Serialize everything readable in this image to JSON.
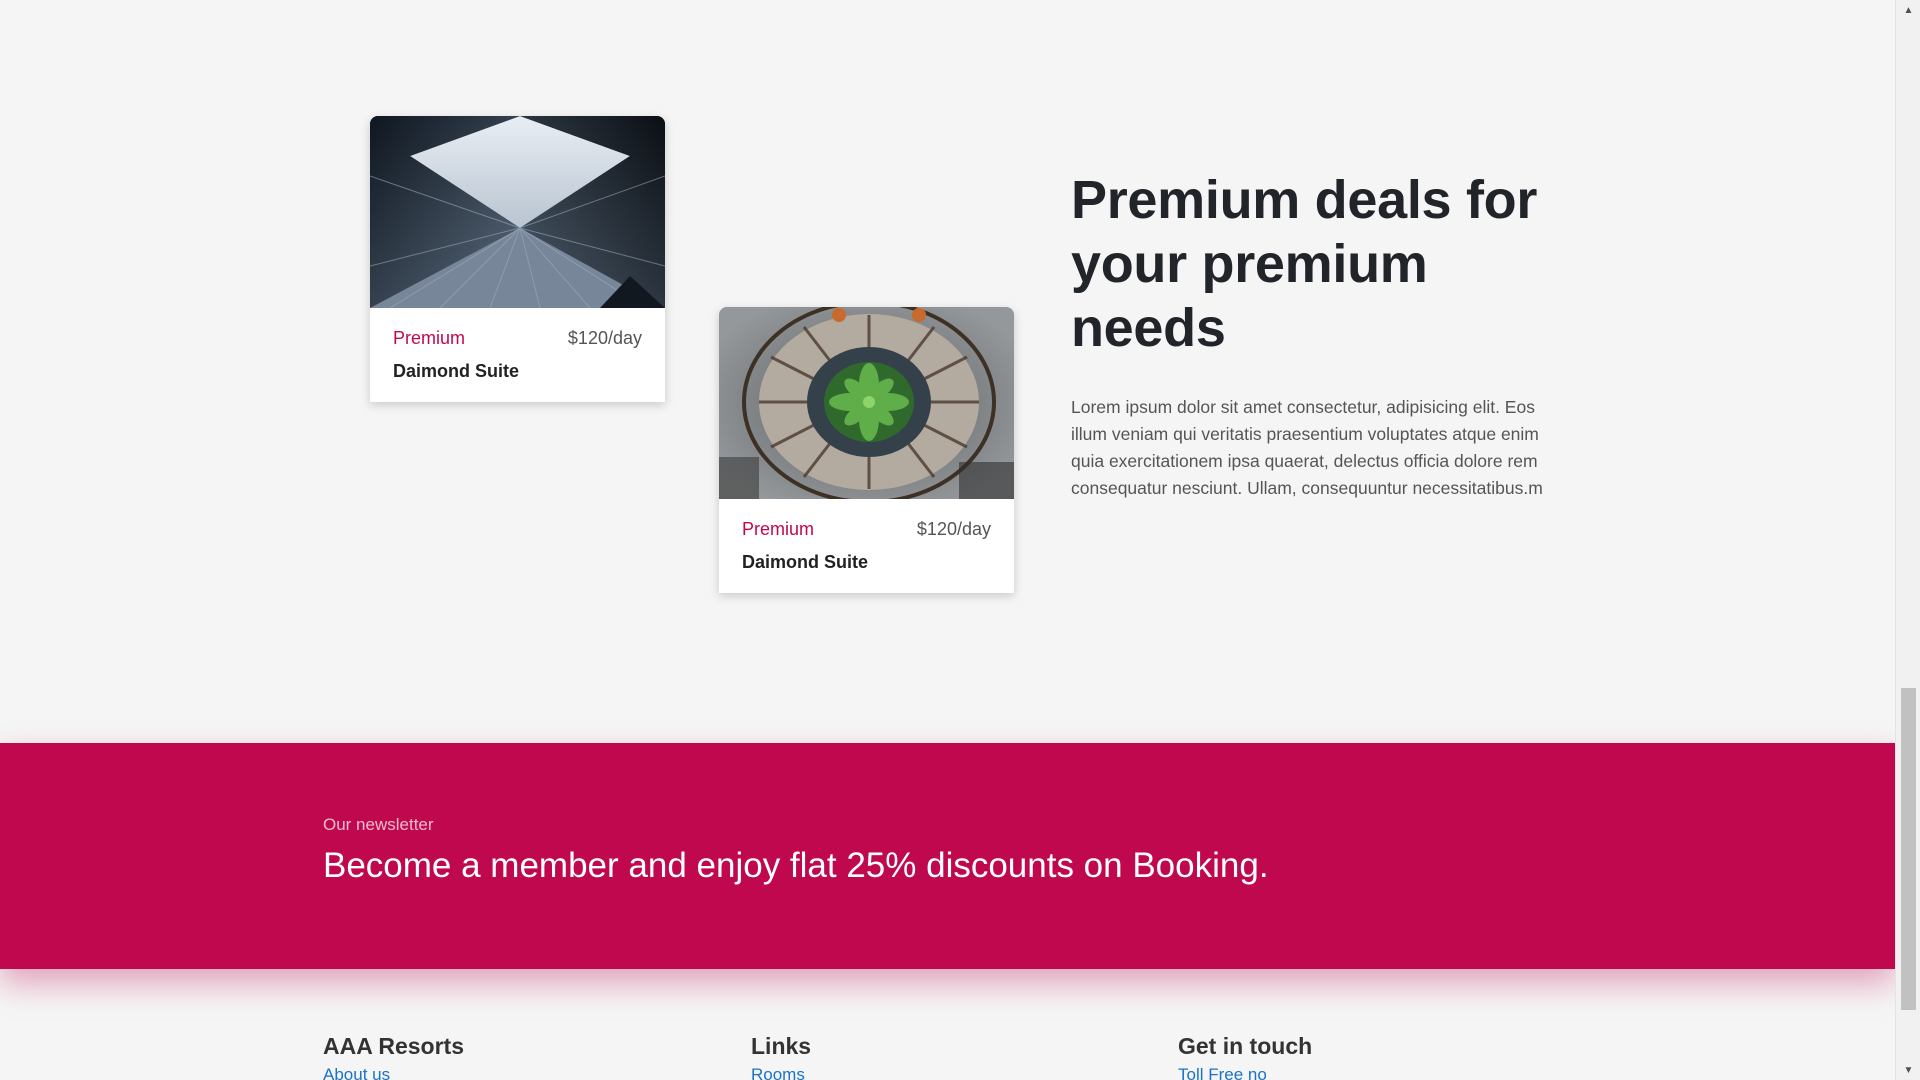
{
  "cards": [
    {
      "tag": "Premium",
      "price": "$120/day",
      "name": "Daimond Suite",
      "image_icon": "building-photo"
    },
    {
      "tag": "Premium",
      "price": "$120/day",
      "name": "Daimond Suite",
      "image_icon": "spiral-staircase-photo"
    }
  ],
  "deal": {
    "heading": "Premium deals for your premium needs",
    "paragraph": "Lorem ipsum dolor sit amet consectetur, adipisicing elit. Eos illum veniam qui veritatis praesentium voluptates atque enim quia exercitationem ipsa quaerat, delectus officia dolore rem consequatur nesciunt. Ullam, consequuntur necessitatibus.m"
  },
  "newsletter": {
    "kicker": "Our newsletter",
    "title": "Become a member and enjoy flat 25% discounts on Booking."
  },
  "footer": {
    "col1": {
      "heading": "AAA Resorts",
      "link": "About us"
    },
    "col2": {
      "heading": "Links",
      "link": "Rooms"
    },
    "col3": {
      "heading": "Get in touch",
      "link": "Toll Free no"
    }
  },
  "colors": {
    "accent": "#c0084f",
    "background": "#f5f5f5",
    "link": "#1a73c8"
  }
}
